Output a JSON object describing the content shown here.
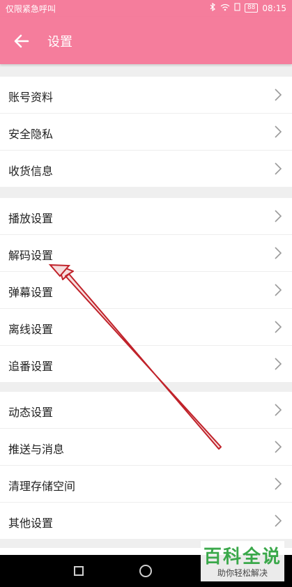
{
  "status_bar": {
    "carrier_text": "仅限紧急呼叫",
    "battery": "88",
    "time": "08:15"
  },
  "app_bar": {
    "title": "设置",
    "back_icon": "arrow-left-icon"
  },
  "sections": [
    {
      "items": [
        {
          "label": "账号资料"
        },
        {
          "label": "安全隐私"
        },
        {
          "label": "收货信息"
        }
      ]
    },
    {
      "items": [
        {
          "label": "播放设置"
        },
        {
          "label": "解码设置"
        },
        {
          "label": "弹幕设置"
        },
        {
          "label": "离线设置"
        },
        {
          "label": "追番设置"
        }
      ]
    },
    {
      "items": [
        {
          "label": "动态设置"
        },
        {
          "label": "推送与消息"
        },
        {
          "label": "清理存储空间"
        },
        {
          "label": "其他设置"
        }
      ]
    }
  ],
  "watermark": {
    "title": "百科全说",
    "subtitle": "助你轻松解决"
  },
  "colors": {
    "accent": "#f57d9c",
    "annotation_arrow": "#c0222a"
  }
}
